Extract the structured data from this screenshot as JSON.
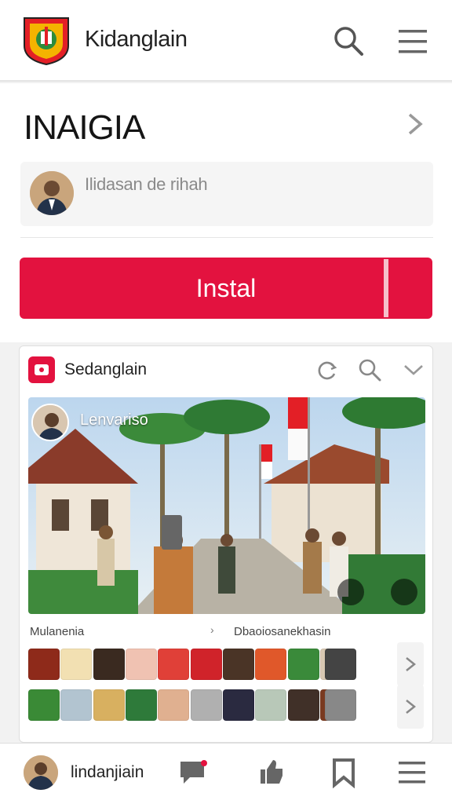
{
  "header": {
    "app_title": "Kidanglain"
  },
  "hero": {
    "heading": "INAIGIA",
    "profile_text": "Ilidasan de rihah",
    "install_label": "Instal"
  },
  "panel": {
    "title": "Sedanglain",
    "photo_caption": "Lenvariso",
    "left_label": "Mulanenia",
    "right_label": "Dbaoiosanekhasin"
  },
  "bottom": {
    "title": "lindanjiain"
  },
  "colors": {
    "accent": "#e3123f",
    "background": "#f2f2f2"
  },
  "icons": [
    "search-icon",
    "menu-icon",
    "chevron-right-icon",
    "refresh-icon",
    "chevron-down-icon",
    "chat-icon",
    "like-icon",
    "bookmark-icon"
  ]
}
